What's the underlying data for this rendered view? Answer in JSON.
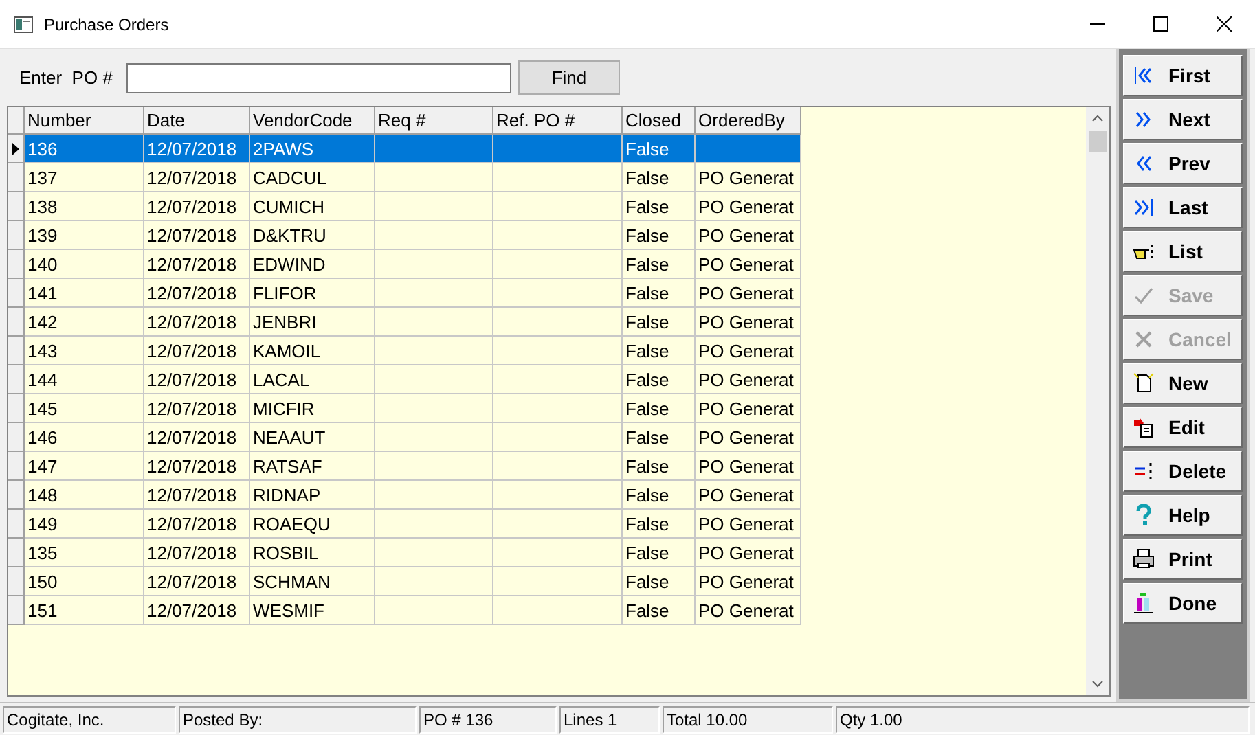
{
  "window": {
    "title": "Purchase Orders"
  },
  "search": {
    "label": "Enter  PO #",
    "button": "Find"
  },
  "table": {
    "columns": [
      "Number",
      "Date",
      "VendorCode",
      "Req #",
      "Ref. PO #",
      "Closed",
      "OrderedBy"
    ],
    "rows": [
      {
        "cells": [
          "136",
          "12/07/2018",
          "2PAWS",
          "",
          "",
          "False",
          ""
        ],
        "selected": true
      },
      {
        "cells": [
          "137",
          "12/07/2018",
          "CADCUL",
          "",
          "",
          "False",
          "PO Generat"
        ],
        "selected": false
      },
      {
        "cells": [
          "138",
          "12/07/2018",
          "CUMICH",
          "",
          "",
          "False",
          "PO Generat"
        ],
        "selected": false
      },
      {
        "cells": [
          "139",
          "12/07/2018",
          "D&KTRU",
          "",
          "",
          "False",
          "PO Generat"
        ],
        "selected": false
      },
      {
        "cells": [
          "140",
          "12/07/2018",
          "EDWIND",
          "",
          "",
          "False",
          "PO Generat"
        ],
        "selected": false
      },
      {
        "cells": [
          "141",
          "12/07/2018",
          "FLIFOR",
          "",
          "",
          "False",
          "PO Generat"
        ],
        "selected": false
      },
      {
        "cells": [
          "142",
          "12/07/2018",
          "JENBRI",
          "",
          "",
          "False",
          "PO Generat"
        ],
        "selected": false
      },
      {
        "cells": [
          "143",
          "12/07/2018",
          "KAMOIL",
          "",
          "",
          "False",
          "PO Generat"
        ],
        "selected": false
      },
      {
        "cells": [
          "144",
          "12/07/2018",
          "LACAL",
          "",
          "",
          "False",
          "PO Generat"
        ],
        "selected": false
      },
      {
        "cells": [
          "145",
          "12/07/2018",
          "MICFIR",
          "",
          "",
          "False",
          "PO Generat"
        ],
        "selected": false
      },
      {
        "cells": [
          "146",
          "12/07/2018",
          "NEAAUT",
          "",
          "",
          "False",
          "PO Generat"
        ],
        "selected": false
      },
      {
        "cells": [
          "147",
          "12/07/2018",
          "RATSAF",
          "",
          "",
          "False",
          "PO Generat"
        ],
        "selected": false
      },
      {
        "cells": [
          "148",
          "12/07/2018",
          "RIDNAP",
          "",
          "",
          "False",
          "PO Generat"
        ],
        "selected": false
      },
      {
        "cells": [
          "149",
          "12/07/2018",
          "ROAEQU",
          "",
          "",
          "False",
          "PO Generat"
        ],
        "selected": false
      },
      {
        "cells": [
          "135",
          "12/07/2018",
          "ROSBIL",
          "",
          "",
          "False",
          "PO Generat"
        ],
        "selected": false
      },
      {
        "cells": [
          "150",
          "12/07/2018",
          "SCHMAN",
          "",
          "",
          "False",
          "PO Generat"
        ],
        "selected": false
      },
      {
        "cells": [
          "151",
          "12/07/2018",
          "WESMIF",
          "",
          "",
          "False",
          "PO Generat"
        ],
        "selected": false
      }
    ]
  },
  "toolbar": [
    {
      "label": "First",
      "kind": "first",
      "disabled": false
    },
    {
      "label": "Next",
      "kind": "next",
      "disabled": false
    },
    {
      "label": "Prev",
      "kind": "prev",
      "disabled": false
    },
    {
      "label": "Last",
      "kind": "last",
      "disabled": false
    },
    {
      "label": "List",
      "kind": "list",
      "disabled": false
    },
    {
      "label": "Save",
      "kind": "save",
      "disabled": true
    },
    {
      "label": "Cancel",
      "kind": "cancel",
      "disabled": true
    },
    {
      "label": "New",
      "kind": "new",
      "disabled": false
    },
    {
      "label": "Edit",
      "kind": "edit",
      "disabled": false
    },
    {
      "label": "Delete",
      "kind": "delete",
      "disabled": false
    },
    {
      "label": "Help",
      "kind": "help",
      "disabled": false
    },
    {
      "label": "Print",
      "kind": "print",
      "disabled": false
    },
    {
      "label": "Done",
      "kind": "done",
      "disabled": false
    }
  ],
  "status_bar": [
    "Cogitate, Inc.",
    "Posted By:",
    "PO # 136",
    "Lines 1",
    "Total 10.00",
    "Qty 1.00"
  ]
}
